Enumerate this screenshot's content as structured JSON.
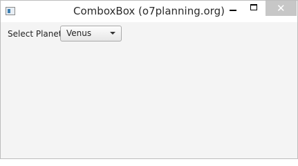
{
  "window": {
    "title": "ComboxBox (o7planning.org)",
    "icons": {
      "app": "app-window-icon",
      "minimize": "minimize-icon",
      "maximize": "maximize-icon",
      "close": "close-icon"
    },
    "close_glyph": "✕"
  },
  "form": {
    "planet_label": "Select Planet:",
    "planet_selected": "Venus"
  },
  "colors": {
    "close_button_bg": "#c7c7c7",
    "content_bg": "#f4f4f4"
  }
}
